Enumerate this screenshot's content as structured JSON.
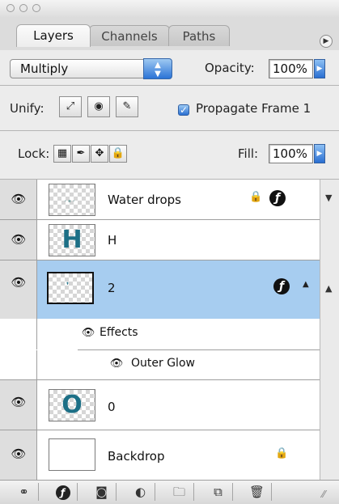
{
  "window": {
    "title": ""
  },
  "tabs": [
    {
      "label": "Layers",
      "active": true
    },
    {
      "label": "Channels",
      "active": false
    },
    {
      "label": "Paths",
      "active": false
    }
  ],
  "blend": {
    "mode": "Multiply",
    "opacity_label": "Opacity:",
    "opacity_value": "100%"
  },
  "unify": {
    "label": "Unify:",
    "propagate_label": "Propagate Frame 1",
    "propagate_checked": true
  },
  "lock": {
    "label": "Lock:",
    "fill_label": "Fill:",
    "fill_value": "100%"
  },
  "layers": [
    {
      "name": "Water drops",
      "thumb": "",
      "visible": true,
      "locked": true,
      "fx": true,
      "selected": false
    },
    {
      "name": "H",
      "thumb": "H",
      "visible": true,
      "locked": false,
      "fx": false,
      "selected": false
    },
    {
      "name": "2",
      "thumb": "",
      "visible": true,
      "locked": false,
      "fx": true,
      "selected": true,
      "effects": {
        "label": "Effects",
        "items": [
          "Outer Glow"
        ]
      }
    },
    {
      "name": "0",
      "thumb": "O",
      "visible": true,
      "locked": false,
      "fx": false,
      "selected": false
    },
    {
      "name": "Backdrop",
      "thumb": "",
      "visible": true,
      "locked": true,
      "fx": false,
      "selected": false
    }
  ],
  "bottom_buttons": [
    "link-layers",
    "add-style",
    "add-mask",
    "new-fill-adjustment",
    "new-group",
    "new-layer",
    "delete-layer"
  ],
  "colors": {
    "selection": "#a7cdf0",
    "accent_blue": "#2a6fd2",
    "thumb_text": "#1c6f86"
  }
}
